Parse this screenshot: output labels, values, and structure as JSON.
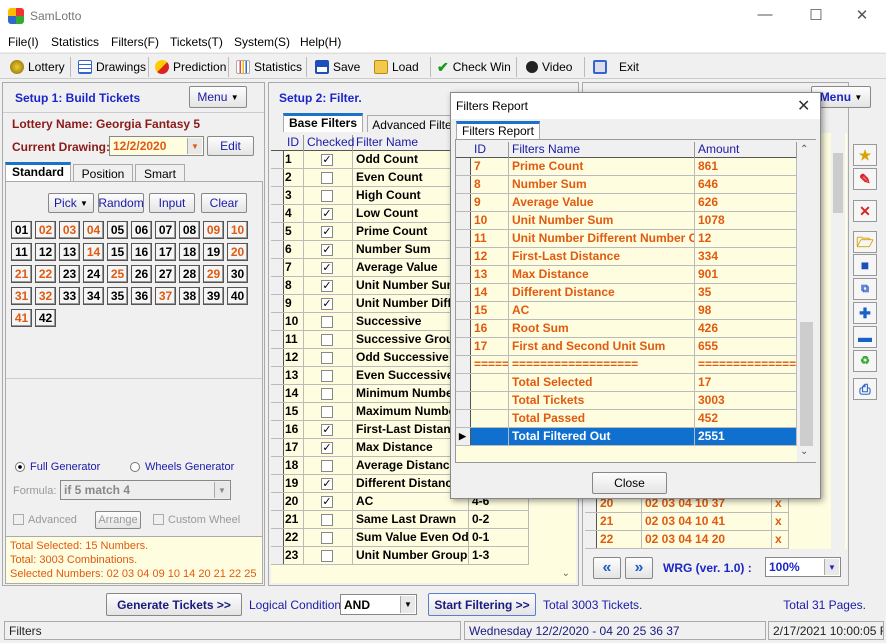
{
  "app": {
    "title": "SamLotto"
  },
  "menu": [
    "File(I)",
    "Statistics",
    "Filters(F)",
    "Tickets(T)",
    "System(S)",
    "Help(H)"
  ],
  "toolbar": [
    {
      "label": "Lottery",
      "icon": "lottery-ball-icon"
    },
    {
      "label": "Drawings",
      "icon": "drawings-icon"
    },
    {
      "label": "Prediction",
      "icon": "prediction-icon"
    },
    {
      "label": "Statistics",
      "icon": "statistics-icon"
    },
    {
      "label": "Save",
      "icon": "save-icon"
    },
    {
      "label": "Load",
      "icon": "folder-open-icon"
    },
    {
      "label": "Check Win",
      "icon": "checkmark-icon"
    },
    {
      "label": "Video",
      "icon": "video-icon"
    },
    {
      "label": "Exit",
      "icon": "exit-icon"
    }
  ],
  "setup1": {
    "title": "Setup 1: Build  Tickets",
    "menu": "Menu",
    "lottery_label": "Lottery  Name: Georgia Fantasy 5",
    "drawing_label": "Current Drawing:",
    "drawing_value": "12/2/2020",
    "edit": "Edit",
    "tabs": [
      "Standard",
      "Position",
      "Smart"
    ],
    "pick": "Pick",
    "random": "Random",
    "input": "Input",
    "clear": "Clear",
    "selected": [
      2,
      3,
      4,
      9,
      10,
      14,
      20,
      21,
      22,
      25,
      29,
      31,
      32,
      37,
      41
    ],
    "full_generator": "Full Generator",
    "wheels_generator": "Wheels Generator",
    "formula_label": "Formula:",
    "formula_value": "if 5 match 4",
    "advanced": "Advanced",
    "arrange": "Arrange",
    "custom_wheel": "Custom Wheel",
    "info": [
      "Total Selected: 15 Numbers.",
      "Total: 3003 Combinations.",
      "Selected Numbers: 02 03 04 09 10 14 20 21 22 25"
    ]
  },
  "setup2": {
    "title": "Setup 2: Filter.",
    "tabs": [
      "Base Filters",
      "Advanced Filte"
    ],
    "columns": [
      "ID",
      "Checked",
      "Filter Name"
    ],
    "rows": [
      {
        "id": "1",
        "checked": true,
        "name": "Odd Count",
        "range": ""
      },
      {
        "id": "2",
        "checked": false,
        "name": "Even Count",
        "range": ""
      },
      {
        "id": "3",
        "checked": false,
        "name": "High Count",
        "range": ""
      },
      {
        "id": "4",
        "checked": true,
        "name": "Low Count",
        "range": ""
      },
      {
        "id": "5",
        "checked": true,
        "name": "Prime Count",
        "range": ""
      },
      {
        "id": "6",
        "checked": true,
        "name": "Number Sum",
        "range": ""
      },
      {
        "id": "7",
        "checked": true,
        "name": "Average Value",
        "range": ""
      },
      {
        "id": "8",
        "checked": true,
        "name": "Unit Number Sum",
        "range": ""
      },
      {
        "id": "9",
        "checked": true,
        "name": "Unit Number Diff",
        "range": ""
      },
      {
        "id": "10",
        "checked": false,
        "name": "Successive",
        "range": ""
      },
      {
        "id": "11",
        "checked": false,
        "name": "Successive Grou",
        "range": ""
      },
      {
        "id": "12",
        "checked": false,
        "name": "Odd Successive",
        "range": ""
      },
      {
        "id": "13",
        "checked": false,
        "name": "Even Successive",
        "range": ""
      },
      {
        "id": "14",
        "checked": false,
        "name": "Minimum Number",
        "range": ""
      },
      {
        "id": "15",
        "checked": false,
        "name": "Maximum Numbe",
        "range": ""
      },
      {
        "id": "16",
        "checked": true,
        "name": "First-Last Distanc",
        "range": ""
      },
      {
        "id": "17",
        "checked": true,
        "name": "Max Distance",
        "range": ""
      },
      {
        "id": "18",
        "checked": false,
        "name": "Average Distanc",
        "range": ""
      },
      {
        "id": "19",
        "checked": true,
        "name": "Different Distanc",
        "range": ""
      },
      {
        "id": "20",
        "checked": true,
        "name": "AC",
        "range": "4-6"
      },
      {
        "id": "21",
        "checked": false,
        "name": "Same Last Drawn",
        "range": "0-2"
      },
      {
        "id": "22",
        "checked": false,
        "name": "Sum Value Even Od",
        "range": "0-1"
      },
      {
        "id": "23",
        "checked": false,
        "name": "Unit Number Group",
        "range": "1-3"
      }
    ]
  },
  "setup3": {
    "menu": "Menu",
    "rows": [
      {
        "id": "20",
        "numbers": "02 03 04 10 37",
        "mark": "x"
      },
      {
        "id": "21",
        "numbers": "02 03 04 10 41",
        "mark": "x"
      },
      {
        "id": "22",
        "numbers": "02 03 04 14 20",
        "mark": "x"
      }
    ],
    "version": "WRG (ver. 1.0) :",
    "zoom": "100%"
  },
  "dialog": {
    "title": "Filters Report",
    "tab": "Filters Report",
    "columns": [
      "ID",
      "Filters Name",
      "Amount"
    ],
    "rows": [
      {
        "id": "7",
        "name": "Prime Count",
        "amount": "861"
      },
      {
        "id": "8",
        "name": "Number Sum",
        "amount": "646"
      },
      {
        "id": "9",
        "name": "Average Value",
        "amount": "626"
      },
      {
        "id": "10",
        "name": "Unit Number Sum",
        "amount": "1078"
      },
      {
        "id": "11",
        "name": "Unit Number Different Number C",
        "amount": "12"
      },
      {
        "id": "12",
        "name": "First-Last Distance",
        "amount": "334"
      },
      {
        "id": "13",
        "name": "Max Distance",
        "amount": "901"
      },
      {
        "id": "14",
        "name": "Different Distance",
        "amount": "35"
      },
      {
        "id": "15",
        "name": "AC",
        "amount": "98"
      },
      {
        "id": "16",
        "name": "Root Sum",
        "amount": "426"
      },
      {
        "id": "17",
        "name": "First and Second Unit Sum",
        "amount": "655"
      },
      {
        "id": "======",
        "name": "==================",
        "amount": "=============="
      },
      {
        "id": "",
        "name": "Total Selected",
        "amount": "17"
      },
      {
        "id": "",
        "name": "Total Tickets",
        "amount": "3003"
      },
      {
        "id": "",
        "name": "Total Passed",
        "amount": "452"
      },
      {
        "id": "",
        "name": "Total Filtered Out",
        "amount": "2551",
        "selected": true
      }
    ],
    "close": "Close"
  },
  "bottom": {
    "generate": "Generate Tickets >>",
    "logical_label": "Logical Condition:",
    "logical_value": "AND",
    "start": "Start Filtering >>",
    "total_tickets": "Total 3003 Tickets.",
    "total_pages": "Total 31 Pages."
  },
  "statusbar": {
    "left": "Filters",
    "middle": "Wednesday 12/2/2020 - 04 20 25 36 37",
    "right": "2/17/2021 10:00:05 F"
  },
  "colors": {
    "accent": "#1b26c8",
    "selected_number": "#e05a10",
    "grid_bg": "#fffde0",
    "selection": "#1070d0"
  }
}
